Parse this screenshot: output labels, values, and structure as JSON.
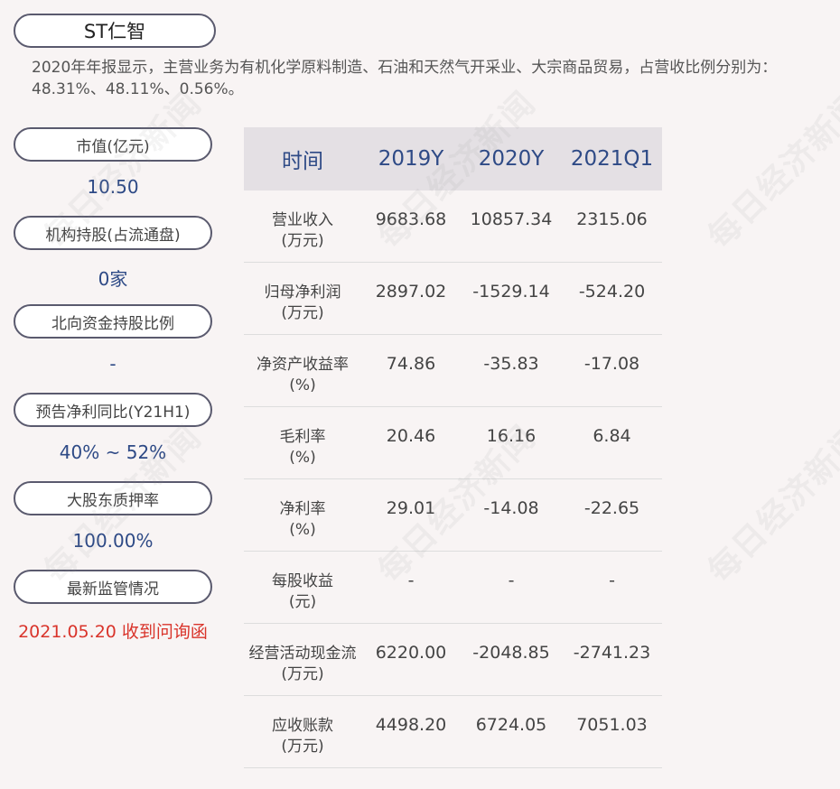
{
  "title": "ST仁智",
  "summary": "2020年年报显示，主营业务为有机化学原料制造、石油和天然气开采业、大宗商品贸易，占营收比例分别为：48.31%、48.11%、0.56%。",
  "watermark_text": "每日经济新闻",
  "metrics": [
    {
      "label": "市值(亿元)",
      "value": "10.50"
    },
    {
      "label": "机构持股(占流通盘)",
      "value": "0家"
    },
    {
      "label": "北向资金持股比例",
      "value": "-"
    },
    {
      "label": "预告净利同比(Y21H1)",
      "value": "40% ~ 52%"
    },
    {
      "label": "大股东质押率",
      "value": "100.00%"
    },
    {
      "label": "最新监管情况",
      "value": "2021.05.20 收到问询函"
    }
  ],
  "table": {
    "headers": [
      "时间",
      "2019Y",
      "2020Y",
      "2021Q1"
    ],
    "rows": [
      {
        "label": "营业收入",
        "unit": "(万元)",
        "values": [
          "9683.68",
          "10857.34",
          "2315.06"
        ]
      },
      {
        "label": "归母净利润",
        "unit": "(万元)",
        "values": [
          "2897.02",
          "-1529.14",
          "-524.20"
        ]
      },
      {
        "label": "净资产收益率",
        "unit": "(%)",
        "values": [
          "74.86",
          "-35.83",
          "-17.08"
        ]
      },
      {
        "label": "毛利率",
        "unit": "(%)",
        "values": [
          "20.46",
          "16.16",
          "6.84"
        ]
      },
      {
        "label": "净利率",
        "unit": "(%)",
        "values": [
          "29.01",
          "-14.08",
          "-22.65"
        ]
      },
      {
        "label": "每股收益",
        "unit": "(元)",
        "values": [
          "-",
          "-",
          "-"
        ]
      },
      {
        "label": "经营活动现金流",
        "unit": "(万元)",
        "values": [
          "6220.00",
          "-2048.85",
          "-2741.23"
        ]
      },
      {
        "label": "应收账款",
        "unit": "(万元)",
        "values": [
          "4498.20",
          "6724.05",
          "7051.03"
        ]
      }
    ]
  },
  "colors": {
    "background": "#f8f4f4",
    "accent_blue": "#2e4a86",
    "alert_red": "#d9342b",
    "header_bg": "#e4e0e4",
    "pill_border": "#5a5a6e"
  }
}
